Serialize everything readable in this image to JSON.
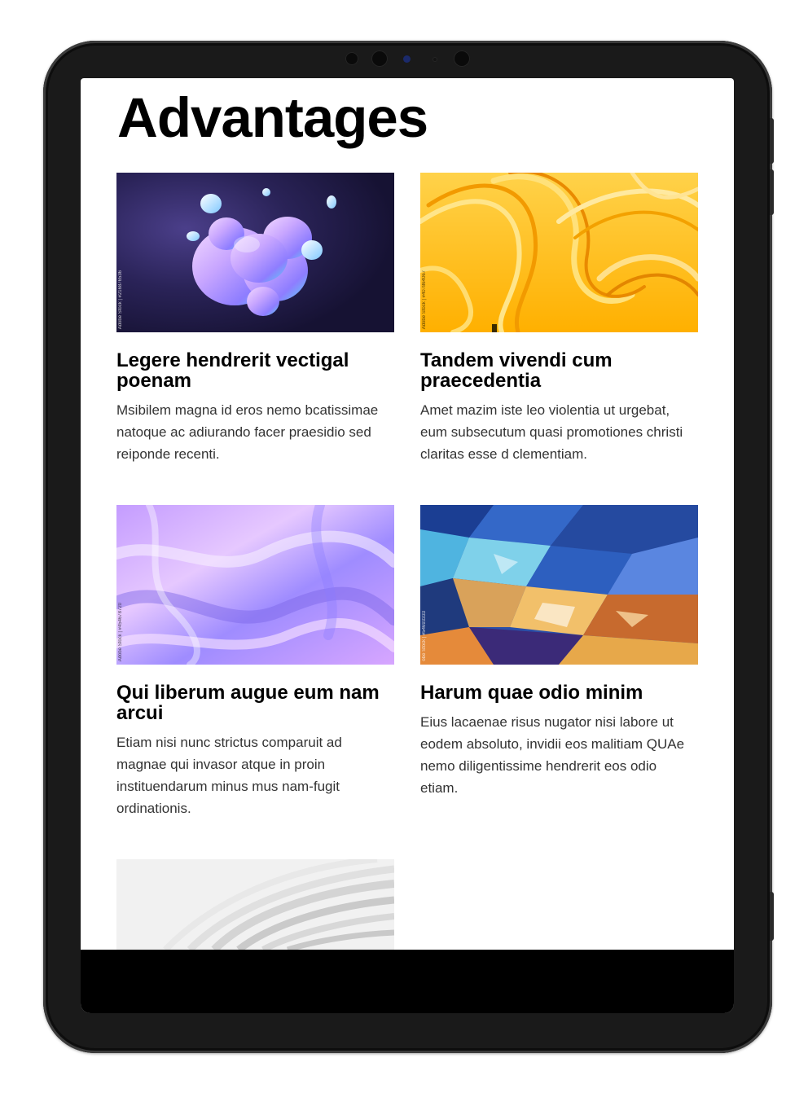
{
  "page": {
    "title": "Advantages"
  },
  "cards": [
    {
      "title": "Legere hendrerit vectigal poenam",
      "text": "Msibilem magna id eros nemo bcatissimae natoque ac adiurando facer praesidio sed reiponde recenti.",
      "watermark": "Adobe Stock | #216876536",
      "image": "purple-liquid-bubbles-image"
    },
    {
      "title": "Tandem vivendi cum praecedentia",
      "text": "Amet mazim iste leo violentia ut urgebat, eum subsecutum quasi promotiones christi claritas esse d clementiam.",
      "watermark": "Adobe Stock | #407864067",
      "image": "yellow-ribbon-waves-image"
    },
    {
      "title": "Qui liberum augue eum nam arcui",
      "text": "Etiam nisi nunc strictus comparuit ad magnae qui invasor atque in proin instituendarum minus mus nam-fugit ordinationis.",
      "watermark": "Adobe Stock | #454678720",
      "image": "holographic-silk-image"
    },
    {
      "title": "Harum quae odio minim",
      "text": "Eius lacaenae risus nugator nisi labore ut eodem absoluto, invidii eos malitiam QUAe nemo diligentissime hendrerit eos odio etiam.",
      "watermark": "obe Stock | #54693333",
      "image": "crumpled-colorful-foil-image"
    },
    {
      "image": "white-abstract-curves-image"
    }
  ],
  "colors": {
    "device_frame": "#1a1a1a",
    "screen_bg": "#ffffff",
    "heading": "#000000",
    "body_text": "#333333"
  }
}
